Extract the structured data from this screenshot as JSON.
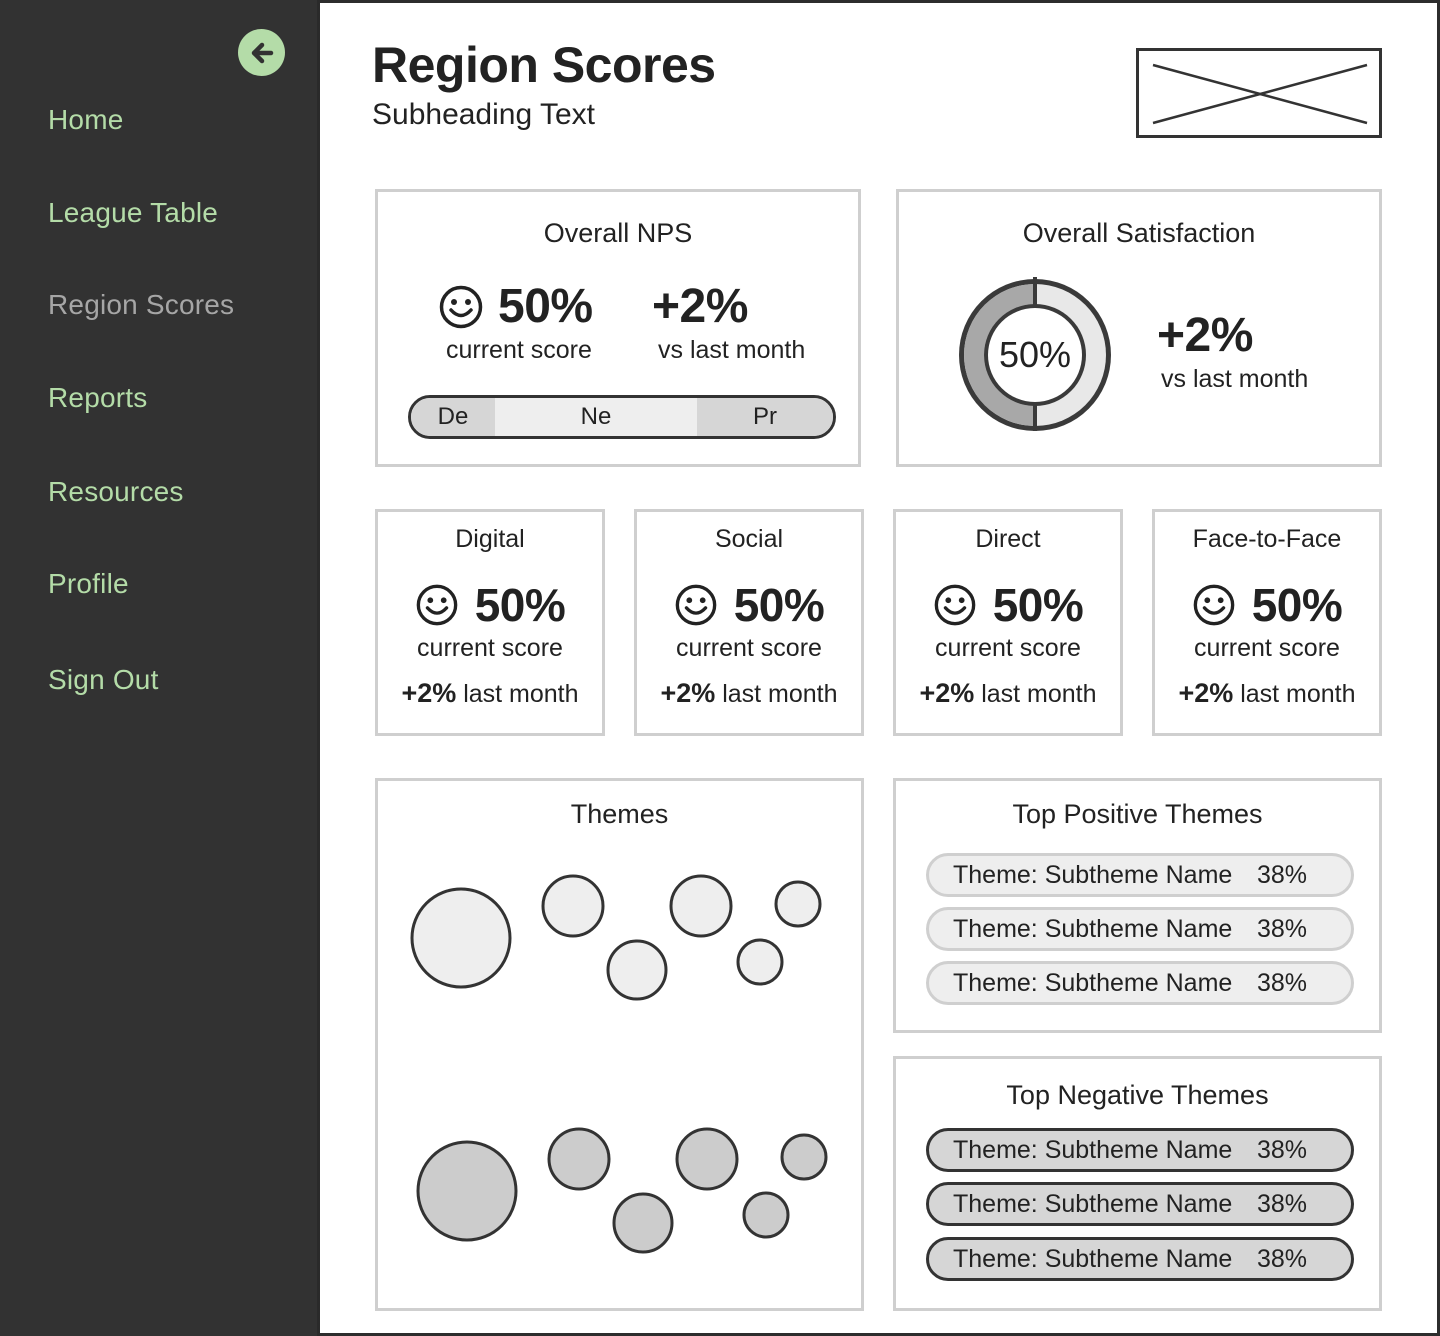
{
  "sidebar": {
    "back_icon": "arrow-left-circle-icon",
    "accent_color": "#b4dca8",
    "background_color": "#323232",
    "items": [
      {
        "label": "Home",
        "active": false
      },
      {
        "label": "League Table",
        "active": false
      },
      {
        "label": "Region Scores",
        "active": true
      },
      {
        "label": "Reports",
        "active": false
      },
      {
        "label": "Resources",
        "active": false
      },
      {
        "label": "Profile",
        "active": false
      },
      {
        "label": "Sign Out",
        "active": false
      }
    ]
  },
  "header": {
    "title": "Region Scores",
    "subtitle": "Subheading Text",
    "logo_icon": "image-placeholder-icon"
  },
  "overall_nps": {
    "title": "Overall NPS",
    "icon": "smiley-face-icon",
    "score": "50%",
    "score_caption": "current score",
    "delta": "+2%",
    "delta_caption": "vs last month",
    "segments": {
      "detractors": "De",
      "neutrals": "Ne",
      "promoters": "Pr"
    }
  },
  "overall_satisfaction": {
    "title": "Overall Satisfaction",
    "donut_label": "50%",
    "fill_fraction": 0.5,
    "delta": "+2%",
    "delta_caption": "vs last month"
  },
  "channels": [
    {
      "title": "Digital",
      "score": "50%",
      "caption": "current score",
      "delta": "+2%",
      "delta_caption": "last month"
    },
    {
      "title": "Social",
      "score": "50%",
      "caption": "current score",
      "delta": "+2%",
      "delta_caption": "last month"
    },
    {
      "title": "Direct",
      "score": "50%",
      "caption": "current score",
      "delta": "+2%",
      "delta_caption": "last month"
    },
    {
      "title": "Face-to-Face",
      "score": "50%",
      "caption": "current score",
      "delta": "+2%",
      "delta_caption": "last month"
    }
  ],
  "themes": {
    "title": "Themes",
    "positive_bubble_color": "#eeeeee",
    "negative_bubble_color": "#cccccc"
  },
  "top_positive": {
    "title": "Top Positive Themes",
    "items": [
      {
        "name": "Theme: Subtheme Name",
        "pct": "38%"
      },
      {
        "name": "Theme: Subtheme Name",
        "pct": "38%"
      },
      {
        "name": "Theme: Subtheme Name",
        "pct": "38%"
      }
    ]
  },
  "top_negative": {
    "title": "Top Negative Themes",
    "items": [
      {
        "name": "Theme: Subtheme Name",
        "pct": "38%"
      },
      {
        "name": "Theme: Subtheme Name",
        "pct": "38%"
      },
      {
        "name": "Theme: Subtheme Name",
        "pct": "38%"
      }
    ]
  }
}
